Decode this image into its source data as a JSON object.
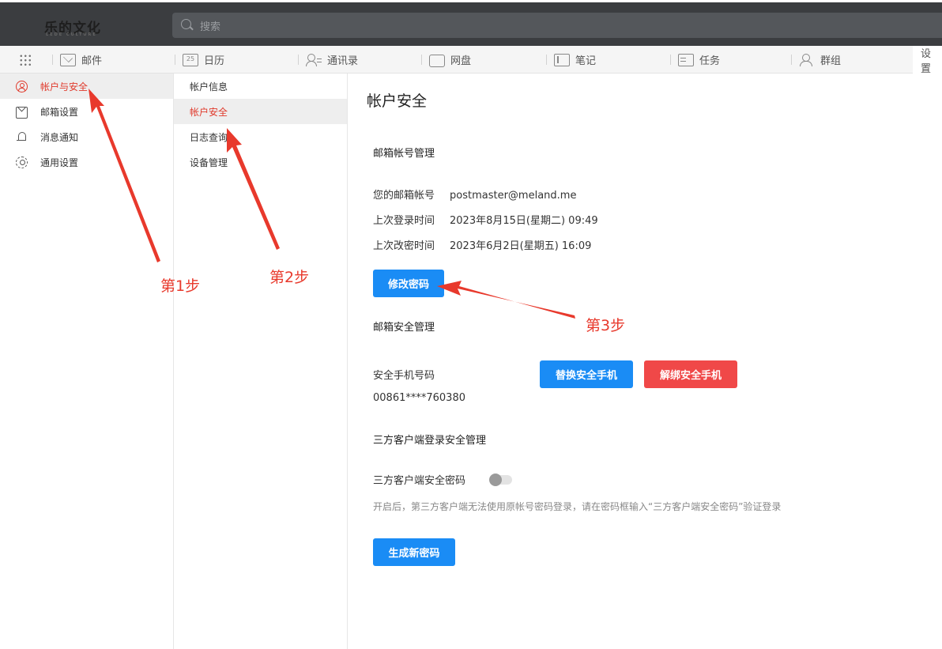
{
  "header": {
    "logo_text": "乐的文化",
    "logo_subtext": "LEDE CULTURE",
    "search_placeholder": "搜索"
  },
  "nav": {
    "apps_icon": "grid-icon",
    "items": [
      {
        "label": "邮件",
        "icon": "mail-icon"
      },
      {
        "label": "日历",
        "icon": "calendar-icon",
        "icon_text": "25"
      },
      {
        "label": "通讯录",
        "icon": "contacts-icon"
      },
      {
        "label": "网盘",
        "icon": "disk-icon"
      },
      {
        "label": "笔记",
        "icon": "note-icon"
      },
      {
        "label": "任务",
        "icon": "task-icon"
      },
      {
        "label": "群组",
        "icon": "group-icon"
      },
      {
        "label": "设置",
        "active": true
      }
    ]
  },
  "sidebar": {
    "items": [
      {
        "label": "帐户与安全",
        "icon": "user-icon",
        "active": true
      },
      {
        "label": "邮箱设置",
        "icon": "mail-icon"
      },
      {
        "label": "消息通知",
        "icon": "bell-icon"
      },
      {
        "label": "通用设置",
        "icon": "gear-icon"
      }
    ]
  },
  "submenu": {
    "items": [
      {
        "label": "帐户信息"
      },
      {
        "label": "帐户安全",
        "active": true
      },
      {
        "label": "日志查询"
      },
      {
        "label": "设备管理"
      }
    ]
  },
  "content": {
    "title": "帐户安全",
    "mailbox_section": {
      "title": "邮箱帐号管理",
      "account_label": "您的邮箱帐号",
      "account_value": "postmaster@meland.me",
      "last_login_label": "上次登录时间",
      "last_login_value": "2023年8月15日(星期二) 09:49",
      "last_pwd_change_label": "上次改密时间",
      "last_pwd_change_value": "2023年6月2日(星期五) 16:09",
      "change_password_button": "修改密码"
    },
    "security_section": {
      "title": "邮箱安全管理",
      "phone_label": "安全手机号码",
      "phone_value": "00861****760380",
      "replace_phone_button": "替换安全手机",
      "unbind_phone_button": "解绑安全手机"
    },
    "third_party_section": {
      "title": "三方客户端登录安全管理",
      "password_label": "三方客户端安全密码",
      "toggle_on": false,
      "hint": "开启后，第三方客户端无法使用原帐号密码登录，请在密码框输入“三方客户端安全密码”验证登录",
      "generate_button": "生成新密码"
    }
  },
  "annotations": {
    "color": "#e8392c",
    "step1": "第1步",
    "step2": "第2步",
    "step3": "第3步"
  },
  "colors": {
    "accent_red": "#e0392b",
    "primary_blue": "#1a8cf5",
    "danger_red": "#f04848",
    "header_dark": "#3b3d40"
  }
}
